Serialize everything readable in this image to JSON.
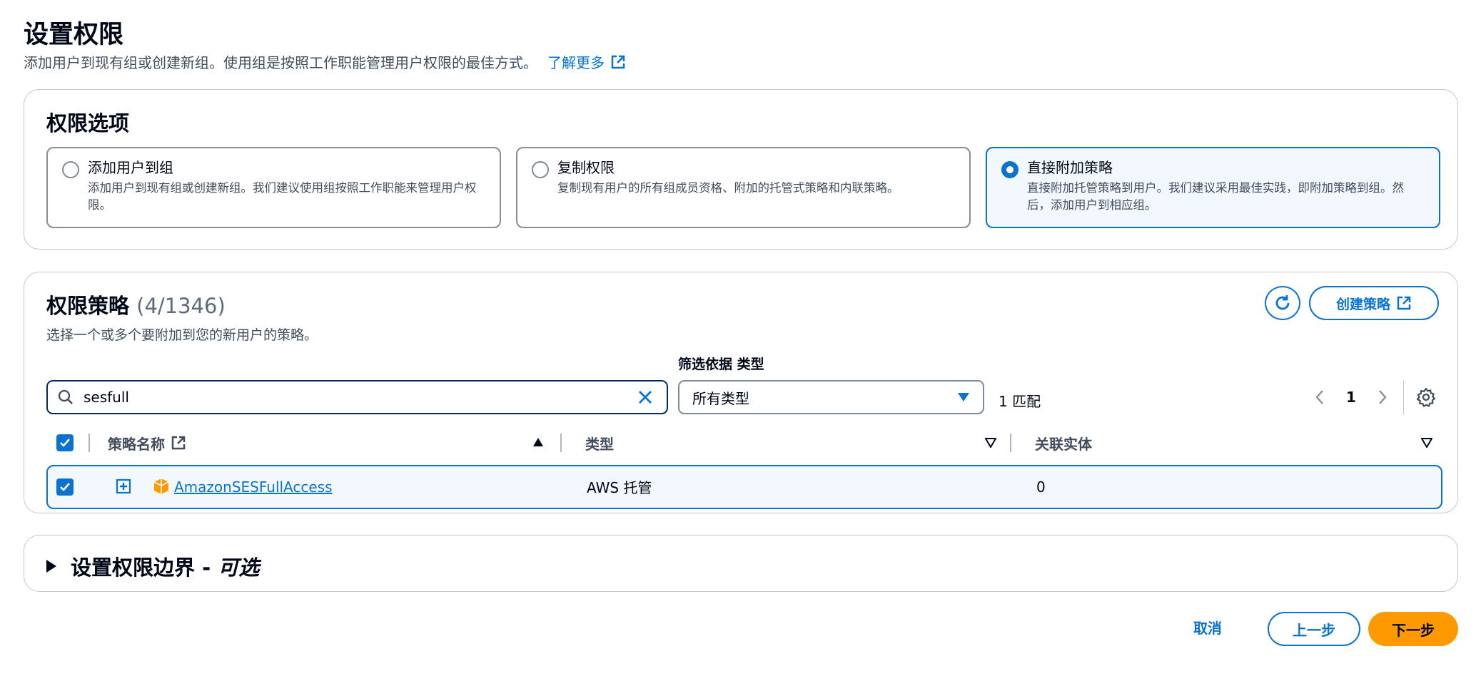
{
  "page": {
    "title": "设置权限",
    "description": "添加用户到现有组或创建新组。使用组是按照工作职能管理用户权限的最佳方式。",
    "learn_more": "了解更多"
  },
  "permission_options": {
    "title": "权限选项",
    "options": [
      {
        "title": "添加用户到组",
        "description": "添加用户到现有组或创建新组。我们建议使用组按照工作职能来管理用户权限。",
        "selected": false
      },
      {
        "title": "复制权限",
        "description": "复制现有用户的所有组成员资格、附加的托管式策略和内联策略。",
        "selected": false
      },
      {
        "title": "直接附加策略",
        "description": "直接附加托管策略到用户。我们建议采用最佳实践，即附加策略到组。然后，添加用户到相应组。",
        "selected": true
      }
    ]
  },
  "policies": {
    "title": "权限策略",
    "count": "(4/1346)",
    "description": "选择一个或多个要附加到您的新用户的策略。",
    "create_button": "创建策略",
    "search_value": "sesfull",
    "filter_label": "筛选依据 类型",
    "filter_value": "所有类型",
    "match_count": "1 匹配",
    "page_number": "1",
    "columns": {
      "name": "策略名称",
      "type": "类型",
      "entities": "关联实体"
    },
    "rows": [
      {
        "name": "AmazonSESFullAccess",
        "type": "AWS 托管",
        "entities": "0",
        "checked": true
      }
    ]
  },
  "boundary": {
    "label": "设置权限边界 - ",
    "optional": "可选"
  },
  "footer": {
    "cancel": "取消",
    "previous": "上一步",
    "next": "下一步"
  },
  "colors": {
    "accent": "#0972d3",
    "primary_button": "#ff9900",
    "selected_bg": "#f2f8fd"
  }
}
